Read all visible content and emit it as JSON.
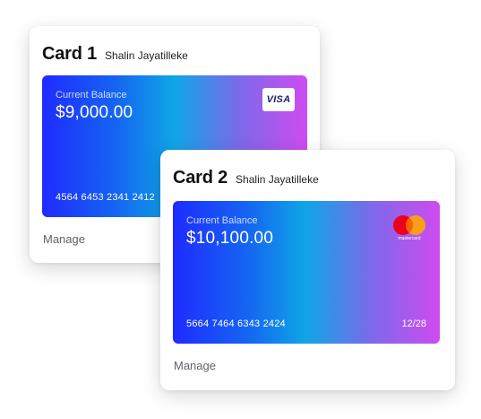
{
  "cards": [
    {
      "title": "Card 1",
      "holder": "Shalin Jayatilleke",
      "balance_label": "Current Balance",
      "balance": "$9,000.00",
      "number": "4564 6453 2341 2412",
      "network": "VISA",
      "network_icon": "visa-logo-icon",
      "manage_label": "Manage"
    },
    {
      "title": "Card 2",
      "holder": "Shalin Jayatilleke",
      "balance_label": "Current Balance",
      "balance": "$10,100.00",
      "number": "5664 7464 6343 2424",
      "expiry": "12/28",
      "network": "mastercard",
      "network_icon": "mastercard-logo-icon",
      "manage_label": "Manage"
    }
  ],
  "colors": {
    "gradient_start": "#1f2bff",
    "gradient_mid": "#0fa6e6",
    "gradient_end": "#cf4bf0",
    "mastercard_red": "#eb001b",
    "mastercard_orange": "#f79e1b",
    "visa_blue": "#1a1f71"
  }
}
